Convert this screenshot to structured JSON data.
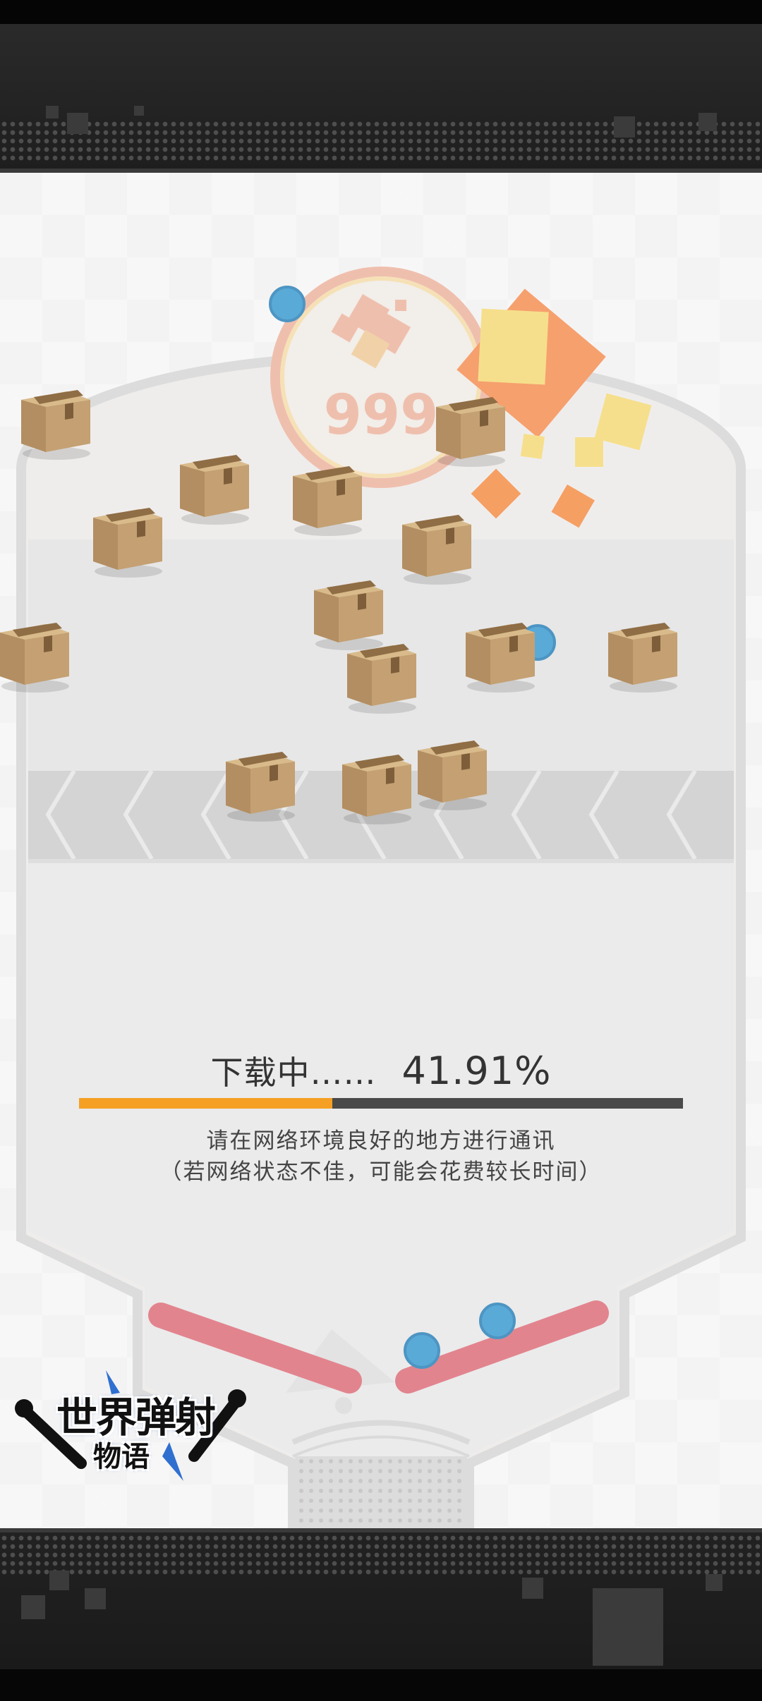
{
  "game": {
    "download_label": "下载中……",
    "progress_text": "41.91%",
    "progress": 0.4191,
    "notice_line1": "请在网络环境良好的地方进行通讯",
    "notice_line2": "（若网络状态不佳，可能会花费较长时间）",
    "bumper_score": "999",
    "logo_line1": "世界弹射",
    "logo_line2": "物语"
  },
  "colors": {
    "progress_fill": "#f5a024",
    "progress_track": "#4a4a4a",
    "flipper": "#e2848e",
    "ball": "#5aaad8",
    "box": "#c4a073"
  }
}
